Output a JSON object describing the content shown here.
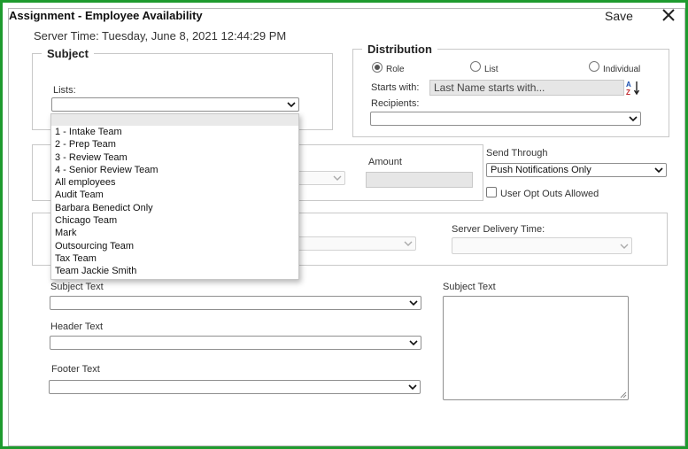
{
  "header": {
    "title": "Assignment - Employee Availability",
    "save_label": "Save",
    "server_time": "Server Time: Tuesday, June 8, 2021 12:44:29 PM"
  },
  "subject": {
    "legend": "Subject",
    "lists_label": "Lists:",
    "lists_value": ""
  },
  "lists_dropdown": {
    "options": [
      "",
      "1 - Intake Team",
      "2 - Prep Team",
      "3 - Review Team",
      "4 - Senior Review Team",
      "All employees",
      "Audit Team",
      "Barbara Benedict Only",
      "Chicago Team",
      "Mark",
      "Outsourcing Team",
      "Tax Team",
      "Team Jackie Smith"
    ]
  },
  "distribution": {
    "legend": "Distribution",
    "radio_role": "Role",
    "radio_list": "List",
    "radio_individual": "Individual",
    "selected": "Role",
    "starts_with_label": "Starts with:",
    "starts_with_value": "Last Name starts with...",
    "recipients_label": "Recipients:",
    "recipients_value": ""
  },
  "amount": {
    "label": "Amount",
    "value": ""
  },
  "send_through": {
    "label": "Send Through",
    "value": "Push Notifications Only",
    "opt_out_label": "User Opt Outs Allowed",
    "opt_out_checked": false
  },
  "delivery": {
    "server_delivery_label": "Server Delivery Time:",
    "server_delivery_value": ""
  },
  "texts": {
    "subject_text_label": "Subject Text",
    "header_text_label": "Header Text",
    "footer_text_label": "Footer Text",
    "subject_text_right_label": "Subject Text"
  },
  "colors": {
    "frame_border": "#1e9b2e"
  }
}
